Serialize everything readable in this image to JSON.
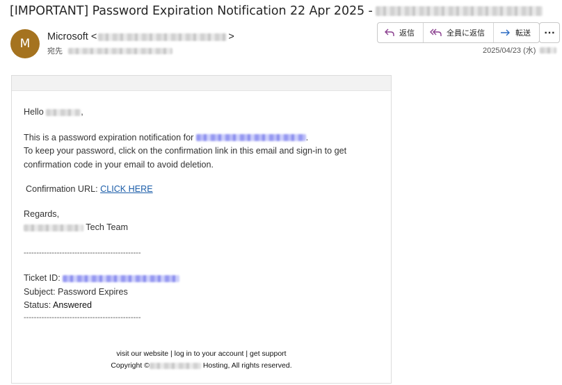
{
  "subject": {
    "prefix": "[IMPORTANT]  Password Expiration Notification  22 Apr 2025 -"
  },
  "sender": {
    "initial": "M",
    "name": "Microsoft",
    "open": "<",
    "close": ">"
  },
  "recipient": {
    "label": "宛先"
  },
  "actions": {
    "reply": "返信",
    "reply_all": "全員に返信",
    "forward": "転送",
    "more": "⋯"
  },
  "date": {
    "value": "2025/04/23 (水)"
  },
  "body": {
    "greeting": "Hello",
    "greeting_end": ",",
    "line1": "This is a password expiration notification for",
    "line1_end": ".",
    "line2": "To keep your password, click on the confirmation link in this email and sign-in to get confirmation code in your email to avoid deletion.",
    "url_label": "Confirmation URL:",
    "url_link": "CLICK HERE",
    "regards": "Regards,",
    "team": "Tech Team",
    "divider": "----------------------------------------------",
    "ticket_label": "Ticket ID:",
    "subject_line": "Subject: Password Expires",
    "status_label": "Status:",
    "status_value": "Answered"
  },
  "footer": {
    "links": "visit our website | log in to your account | get support",
    "copyright_prefix": "Copyright ©",
    "copyright_suffix": "Hosting, All rights reserved."
  },
  "colors": {
    "avatar": "#a5731f",
    "link": "#1a5ca8",
    "action_icon": "#8a3f8f",
    "forward_icon": "#2b6cc4"
  }
}
